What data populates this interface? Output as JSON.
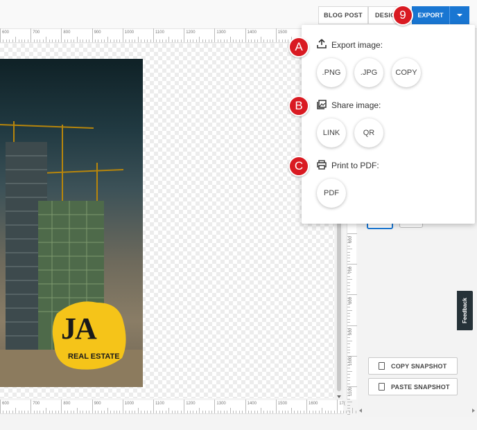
{
  "toolbar": {
    "tabs": [
      {
        "label": "BLOG POST"
      },
      {
        "label": "DESIG"
      }
    ],
    "export_label": "EXPORT",
    "step_badge": "9"
  },
  "ruler": {
    "top_labels": [
      "600",
      "700",
      "800",
      "900",
      "1000",
      "1100",
      "1200",
      "1300",
      "1400",
      "1500"
    ],
    "bottom_labels": [
      "600",
      "700",
      "800",
      "900",
      "1000",
      "1100",
      "1200",
      "1300",
      "1400",
      "1500",
      "1600",
      "17("
    ],
    "side_labels": [
      "600",
      "700",
      "800",
      "900",
      "1000",
      "1100"
    ]
  },
  "design": {
    "logo_text": "JA",
    "logo_subtext": "REAL ESTATE",
    "logo_color": "#f5c419"
  },
  "export_menu": {
    "export_image": {
      "badge": "A",
      "title": "Export image:",
      "buttons": [
        ".PNG",
        ".JPG",
        "COPY"
      ]
    },
    "share_image": {
      "badge": "B",
      "title": "Share image:",
      "buttons": [
        "LINK",
        "QR"
      ]
    },
    "print_pdf": {
      "badge": "C",
      "title": "Print to PDF:",
      "buttons": [
        "PDF"
      ]
    }
  },
  "panel": {
    "copy_snapshot": "COPY SNAPSHOT",
    "paste_snapshot": "PASTE SNAPSHOT",
    "feedback": "Feedback"
  },
  "colors": {
    "accent": "#1976d2",
    "badge": "#d91a22",
    "feedback_bg": "#263238"
  }
}
